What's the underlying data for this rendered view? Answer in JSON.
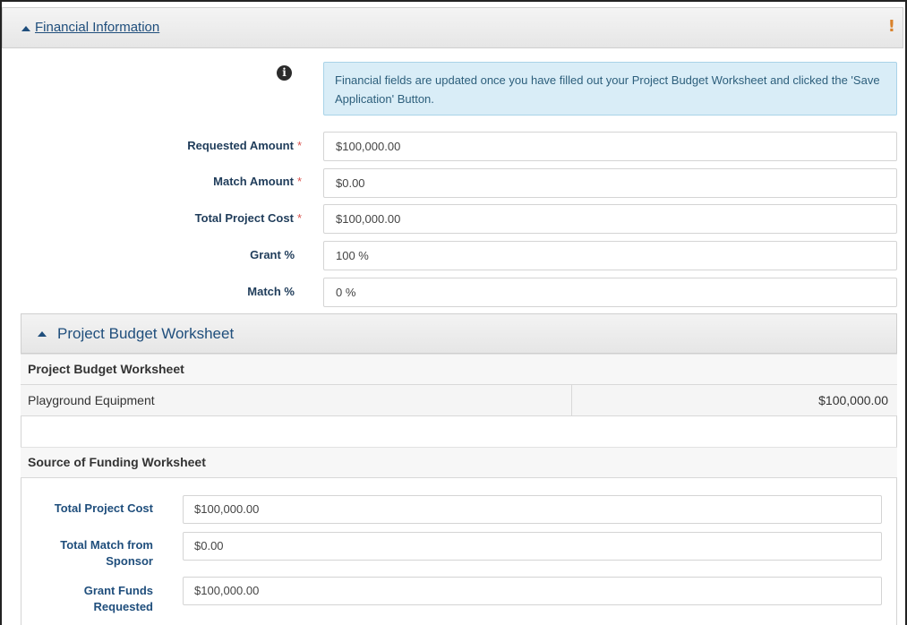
{
  "financial": {
    "title": "Financial Information",
    "info_text": "Financial fields are updated once you have filled out your Project Budget Worksheet and clicked the 'Save Application' Button.",
    "fields": [
      {
        "label": "Requested Amount",
        "required": "*",
        "value": "$100,000.00"
      },
      {
        "label": "Match Amount",
        "required": "*",
        "value": "$0.00"
      },
      {
        "label": "Total Project Cost",
        "required": "*",
        "value": "$100,000.00"
      },
      {
        "label": "Grant %",
        "required": "",
        "value": "100 %"
      },
      {
        "label": "Match %",
        "required": "",
        "value": "0 %"
      }
    ]
  },
  "budget_worksheet": {
    "title": "Project Budget Worksheet",
    "table_heading": "Project Budget Worksheet",
    "rows": [
      {
        "item": "Playground Equipment",
        "amount": "$100,000.00"
      }
    ]
  },
  "funding_worksheet": {
    "heading": "Source of Funding Worksheet",
    "fields": [
      {
        "label": "Total Project Cost",
        "value": "$100,000.00"
      },
      {
        "label": "Total Match from Sponsor",
        "value": "$0.00"
      },
      {
        "label": "Grant Funds Requested",
        "value": "$100,000.00"
      }
    ]
  },
  "colors": {
    "accent": "#1f4e7c",
    "required": "#d9534f",
    "warning": "#d9822b",
    "info_bg": "#d9edf7"
  },
  "icons": {
    "collapse": "caret-up-icon",
    "warning": "exclamation-icon",
    "info": "info-circle-icon"
  }
}
